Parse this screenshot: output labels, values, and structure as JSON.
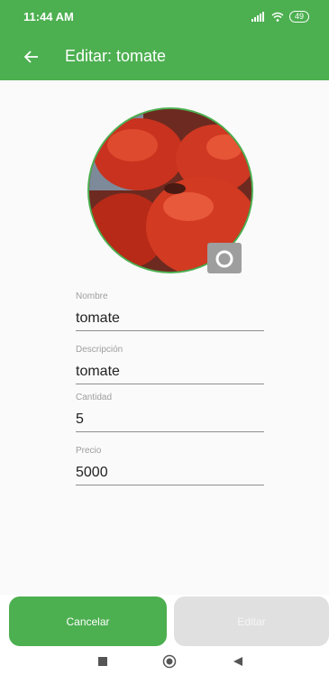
{
  "status_bar": {
    "time": "11:44 AM",
    "battery": "49"
  },
  "app_bar": {
    "title": "Editar: tomate",
    "back_icon": "arrow-left-icon"
  },
  "product_image": {
    "icon": "camera-icon"
  },
  "form": {
    "nombre": {
      "label": "Nombre",
      "value": "tomate"
    },
    "descripcion": {
      "label": "Descripción",
      "value": "tomate"
    },
    "cantidad": {
      "label": "Cantidad",
      "value": "5"
    },
    "precio": {
      "label": "Precio",
      "value": "5000"
    }
  },
  "actions": {
    "cancel_label": "Cancelar",
    "edit_label": "Editar"
  },
  "colors": {
    "primary": "#4CAF50",
    "disabled": "#E0E0E0"
  }
}
